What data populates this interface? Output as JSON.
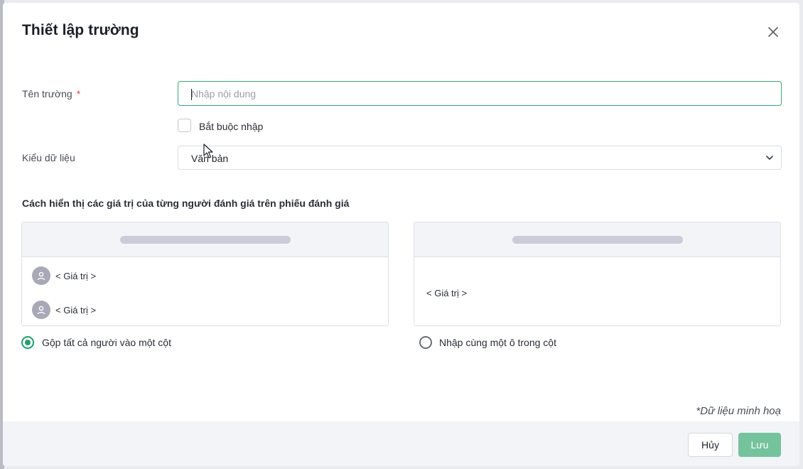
{
  "dialog": {
    "title": "Thiết lập trường",
    "close_icon": "close-icon"
  },
  "form": {
    "field_name_label": "Tên trường",
    "required_mark": "*",
    "field_name_placeholder": "Nhập nội dung",
    "field_name_value": "",
    "required_checkbox_label": "Bắt buộc nhập",
    "required_checked": false,
    "data_type_label": "Kiểu dữ liệu",
    "data_type_value": "Văn bản"
  },
  "display": {
    "section_title": "Cách hiển thị các giá trị của từng người đánh giá trên phiếu đánh giá",
    "option_combined": {
      "rows": [
        "< Giá trị >",
        "< Giá trị >"
      ],
      "label": "Gộp tất cả người vào một cột",
      "selected": true
    },
    "option_single": {
      "value": "< Giá trị >",
      "label": "Nhập cùng một ô trong cột",
      "selected": false
    },
    "note": "*Dữ liệu minh hoạ"
  },
  "footer": {
    "cancel_label": "Hủy",
    "save_label": "Lưu"
  },
  "colors": {
    "accent": "#22a06b",
    "save_button": "#74c39d",
    "input_focus_border": "#3aa676",
    "required_star": "#e5484d"
  }
}
